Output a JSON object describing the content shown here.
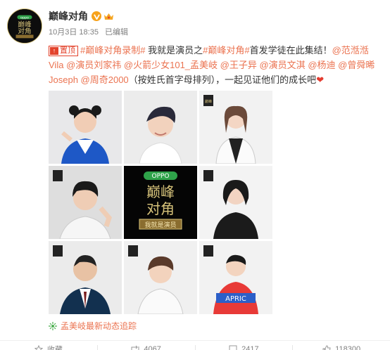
{
  "post": {
    "account_name": "巅峰对角",
    "date": "10月3日 18:35",
    "edited_label": "已编辑",
    "pin_label": "置顶",
    "text_parts": [
      {
        "t": "#巅峰对角录制#",
        "link": true
      },
      {
        "t": " 我就是演员之",
        "link": false
      },
      {
        "t": "#巅峰对角#",
        "link": true
      },
      {
        "t": "首发学徒在此集结！",
        "link": false
      },
      {
        "t": "@范湉湉Vila",
        "link": true
      },
      {
        "t": " ",
        "link": false
      },
      {
        "t": "@演员刘家祎",
        "link": true
      },
      {
        "t": " ",
        "link": false
      },
      {
        "t": "@火箭少女101_孟美岐",
        "link": true
      },
      {
        "t": " ",
        "link": false
      },
      {
        "t": "@王子异",
        "link": true
      },
      {
        "t": " ",
        "link": false
      },
      {
        "t": "@演员文淇",
        "link": true
      },
      {
        "t": " ",
        "link": false
      },
      {
        "t": "@杨迪",
        "link": true
      },
      {
        "t": " ",
        "link": false
      },
      {
        "t": "@曾舜晞Joseph",
        "link": true
      },
      {
        "t": " ",
        "link": false
      },
      {
        "t": "@周奇2000",
        "link": true
      },
      {
        "t": "（按姓氏首字母排列），一起见证他们的成长吧",
        "link": false
      }
    ],
    "heart_emoji": "❤",
    "center_logo": {
      "brand": "OPPO",
      "line1": "巅峰",
      "line2": "对角",
      "banner": "我就是演员"
    },
    "follow_text": "孟美岐最新动态追踪",
    "actions": {
      "favorite_label": "收藏",
      "repost_count": "4067",
      "comment_count": "2417",
      "like_count": "118300"
    }
  },
  "colors": {
    "link": "#eb7350",
    "pin": "#e3432c",
    "gold": "#d6c27a",
    "meta": "#808080"
  },
  "icons": [
    "avatar-logo",
    "verified-v-icon",
    "vip-crown-icon",
    "pin-icon",
    "follow-icon",
    "star-icon",
    "repost-icon",
    "comment-icon",
    "like-icon"
  ]
}
